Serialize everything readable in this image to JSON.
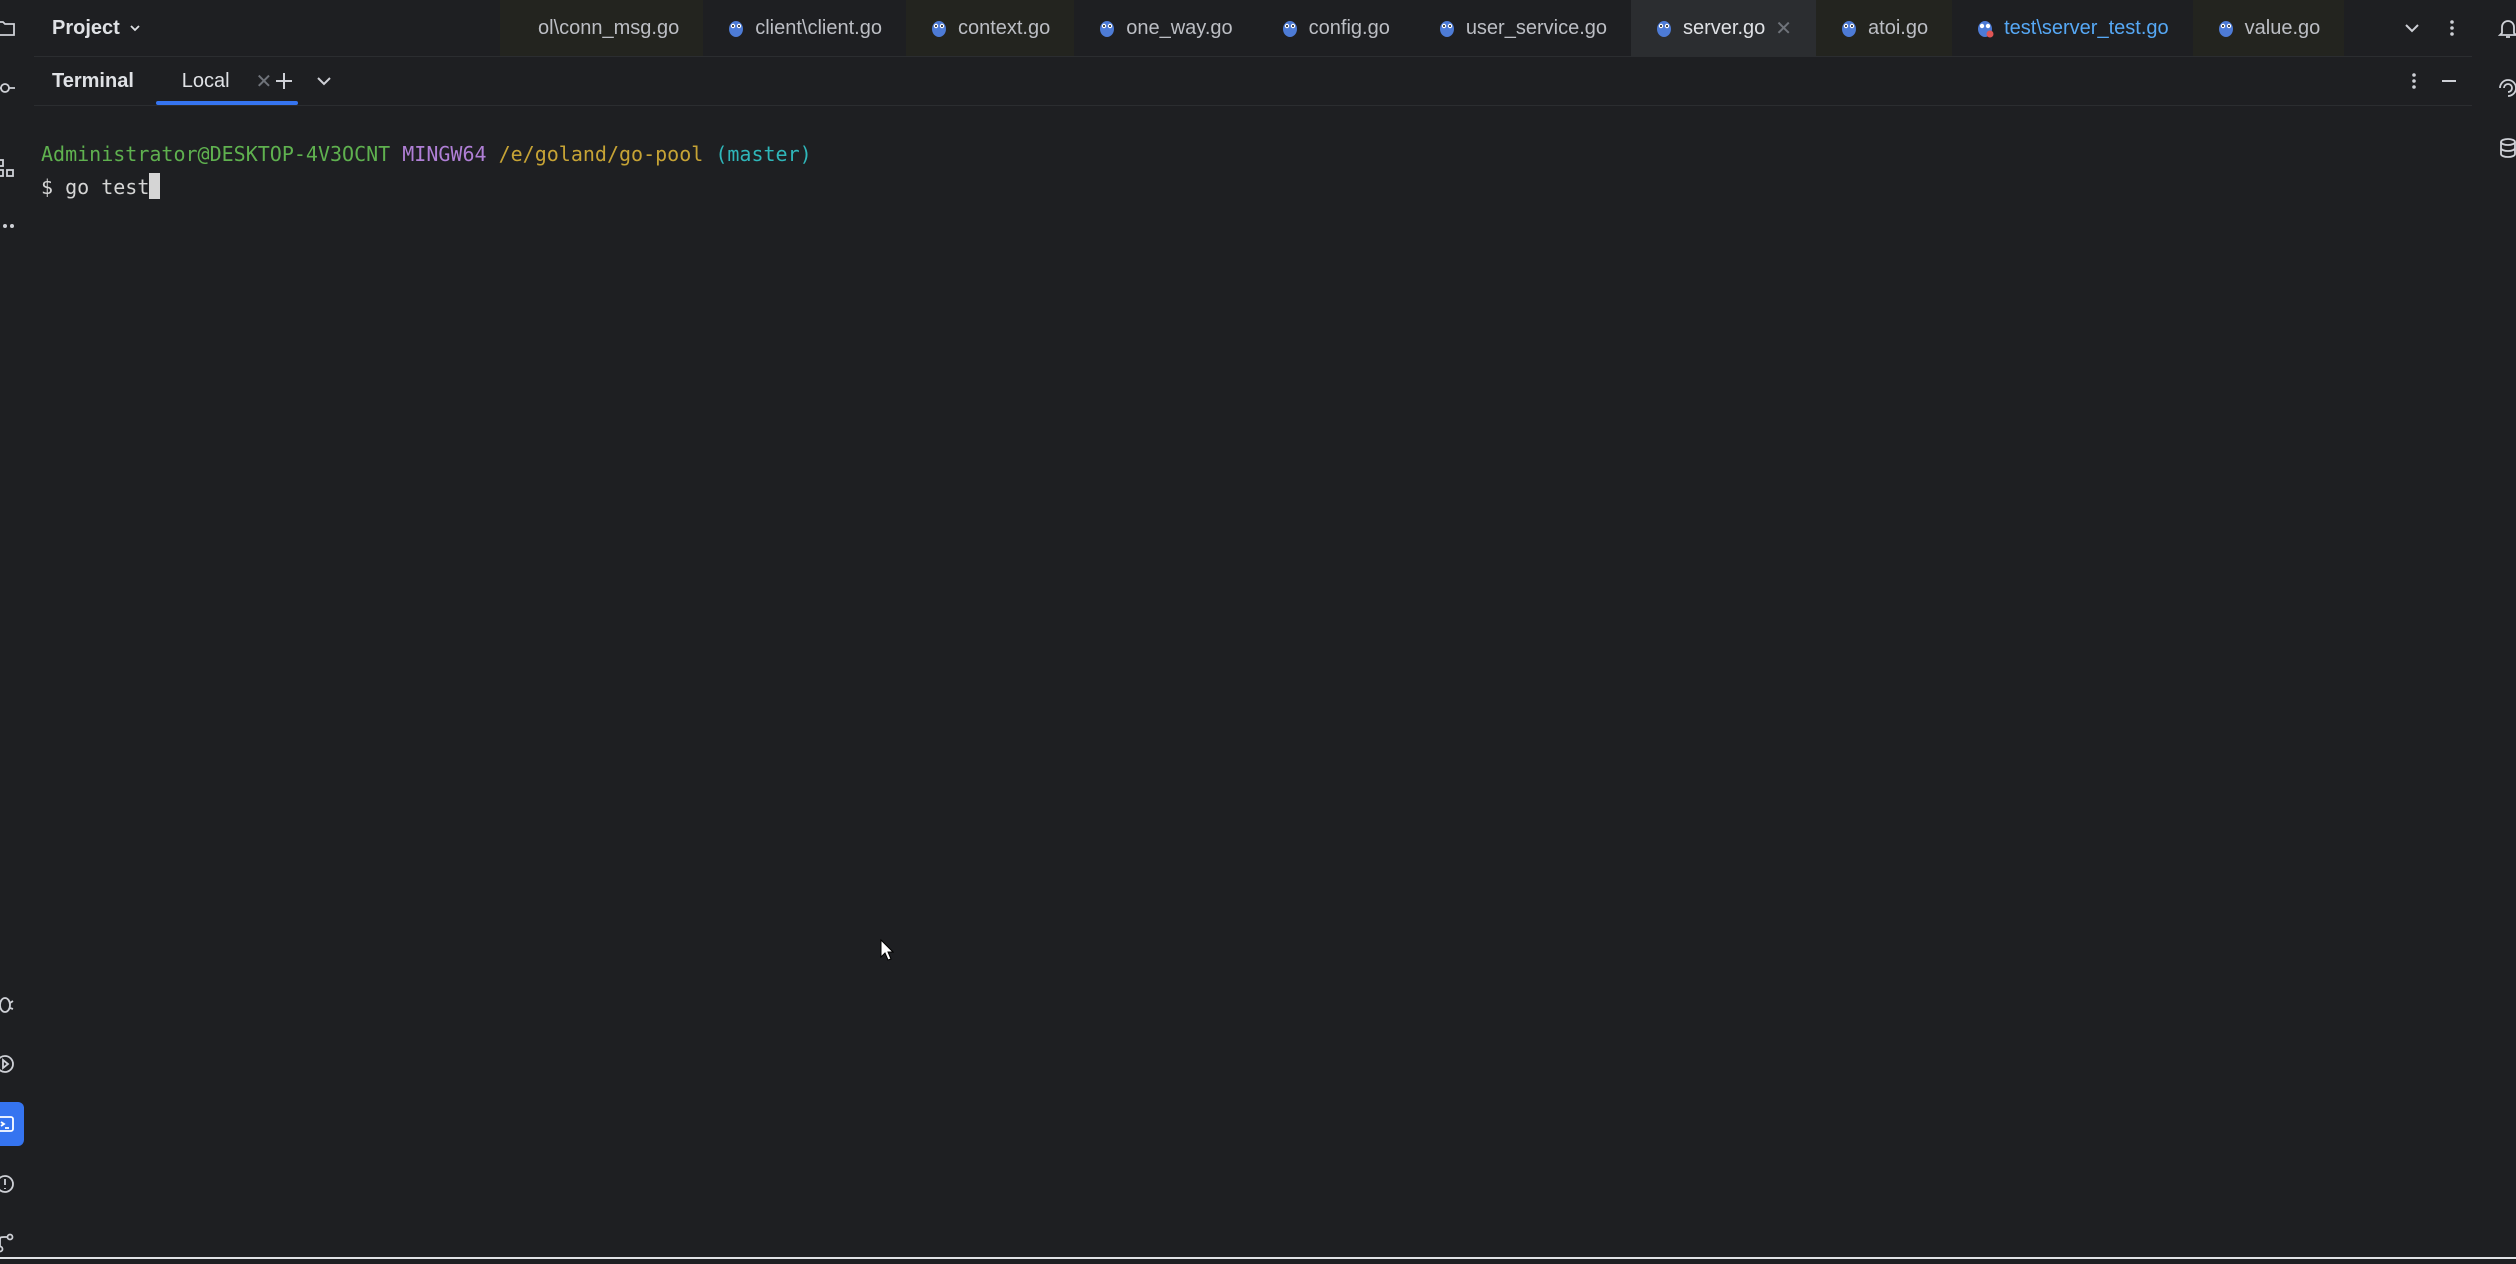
{
  "topbar": {
    "project_label": "Project",
    "tabs": [
      {
        "label": "ol\\conn_msg.go",
        "style": "tinted"
      },
      {
        "label": "client\\client.go",
        "style": ""
      },
      {
        "label": "context.go",
        "style": "tinted"
      },
      {
        "label": "one_way.go",
        "style": ""
      },
      {
        "label": "config.go",
        "style": ""
      },
      {
        "label": "user_service.go",
        "style": ""
      },
      {
        "label": "server.go",
        "style": "active"
      },
      {
        "label": "atoi.go",
        "style": "tinted"
      },
      {
        "label": "test\\server_test.go",
        "style": "test"
      },
      {
        "label": "value.go",
        "style": "tinted"
      }
    ]
  },
  "terminal": {
    "title": "Terminal",
    "tab_label": "Local",
    "prompt": {
      "user_host": "Administrator@DESKTOP-4V3OCNT",
      "system": "MINGW64",
      "path": "/e/goland/go-pool",
      "branch": "(master)"
    },
    "command_line": "$ go test"
  },
  "icons": {
    "left_rail": [
      "folder-icon",
      "commit-icon",
      "structure-icon",
      "more-icon",
      "debug-icon",
      "services-icon",
      "terminal-icon",
      "problems-icon",
      "git-icon"
    ],
    "right_rail": [
      "notifications-icon",
      "ai-assistant-icon",
      "database-icon"
    ]
  },
  "colors": {
    "accent": "#3574f0",
    "prompt_user": "#5fb14f",
    "prompt_system": "#b07fd6",
    "prompt_path": "#c6a335",
    "prompt_branch": "#2fb6b9"
  }
}
